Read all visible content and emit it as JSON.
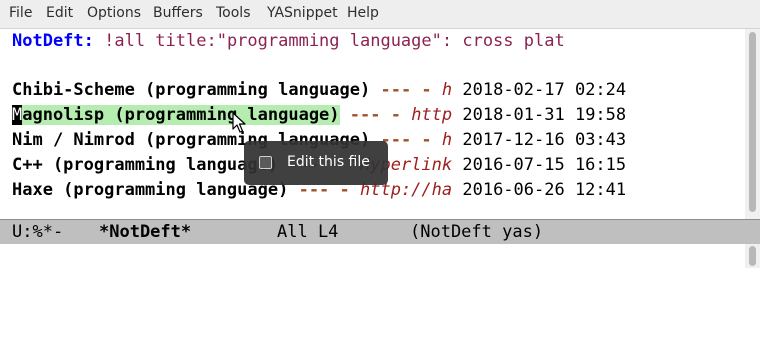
{
  "menubar": {
    "items": [
      "File",
      "Edit",
      "Options",
      "Buffers",
      "Tools",
      "YASnippet",
      "Help"
    ]
  },
  "header": {
    "label": "NotDeft:",
    "query": " !all title:\"programming language\": cross plat"
  },
  "notes": [
    {
      "cursor": "",
      "title": "Chibi-Scheme (programming language)",
      "dashes": " --- -",
      "summary": " h",
      "date": " 2018-02-17 02:24"
    },
    {
      "cursor": "M",
      "title": "agnolisp (programming language)",
      "dashes": " --- -",
      "summary": " http",
      "date": " 2018-01-31 19:58"
    },
    {
      "cursor": "",
      "title": "Nim / Nimrod (programming language)",
      "dashes": " --- -",
      "summary": " h",
      "date": " 2017-12-16 03:43"
    },
    {
      "cursor": "",
      "title": "C++ (programming language)",
      "dashes": " --- -",
      "summary": " \"Hyperlink",
      "date": " 2016-07-15 16:15"
    },
    {
      "cursor": "",
      "title": "Haxe (programming language)",
      "dashes": " --- -",
      "summary": " http://ha",
      "date": " 2016-06-26 12:41"
    }
  ],
  "modeline": {
    "status": "U:%*-",
    "buffer": "*NotDeft*",
    "position": "All L4",
    "modes": "(NotDeft yas)"
  },
  "tooltip": {
    "text": "Edit this file",
    "icon": "window-icon"
  },
  "colors": {
    "header_label": "#0000ff",
    "query": "#8b2252",
    "highlight": "#b5ecb0",
    "dashes": "#a0522d",
    "summary": "#a02020",
    "modeline_bg": "#bfbfbf"
  }
}
